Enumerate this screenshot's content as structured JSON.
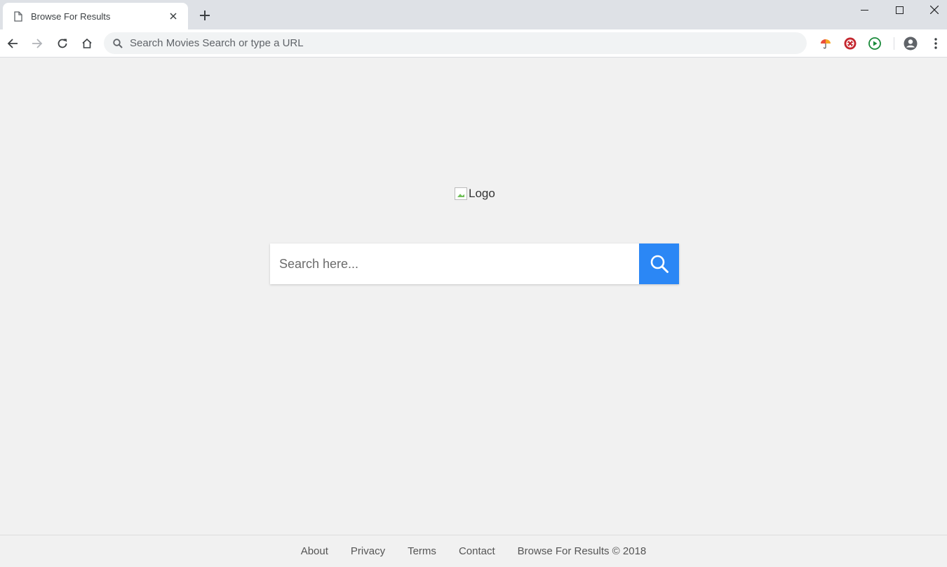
{
  "browser": {
    "tab": {
      "title": "Browse For Results"
    },
    "omnibox": {
      "text": "Search Movies Search or type a URL"
    },
    "colors": {
      "tabstrip": "#dee1e6",
      "toolbar": "#ffffff",
      "omnibox_bg": "#f1f3f4"
    }
  },
  "page": {
    "logo_alt": "Logo",
    "search": {
      "placeholder": "Search here...",
      "button_color": "#2b87f5"
    },
    "background": "#f1f1f1"
  },
  "footer": {
    "links": [
      {
        "label": "About"
      },
      {
        "label": "Privacy"
      },
      {
        "label": "Terms"
      },
      {
        "label": "Contact"
      }
    ],
    "copyright": "Browse For Results © 2018"
  },
  "icons": {
    "extensions": [
      "umbrella-extension-icon",
      "film-reel-extension-icon",
      "play-extension-icon"
    ]
  }
}
